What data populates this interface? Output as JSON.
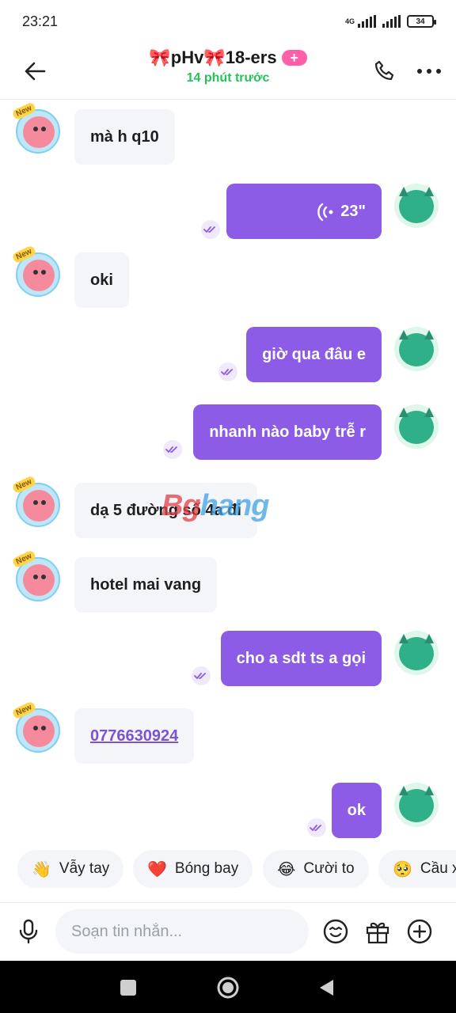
{
  "status_bar": {
    "time": "23:21",
    "network": "4G",
    "battery": "34"
  },
  "header": {
    "title": "🎀pHv🎀18-ers",
    "plus_badge": "+",
    "subtitle": "14 phút trước"
  },
  "messages": [
    {
      "side": "in",
      "text": "mà h q10"
    },
    {
      "side": "out",
      "type": "voice",
      "duration": "23\""
    },
    {
      "side": "in",
      "text": "oki"
    },
    {
      "side": "out",
      "text": "giờ qua đâu e"
    },
    {
      "side": "out",
      "text": "nhanh nào baby trễ r"
    },
    {
      "side": "in",
      "text": "dạ 5 đường số 4a đi"
    },
    {
      "side": "in",
      "text": "hotel mai vang"
    },
    {
      "side": "out",
      "text": "cho a sdt ts a gọi"
    },
    {
      "side": "in",
      "text": "0776630924",
      "link": true
    },
    {
      "side": "out",
      "text": "ok"
    }
  ],
  "watermark": {
    "part1": "Bg",
    "part2": "hang"
  },
  "quick_reactions": [
    {
      "emoji": "👋",
      "label": "Vẫy tay"
    },
    {
      "emoji": "❤️",
      "label": "Bóng bay"
    },
    {
      "emoji": "😂",
      "label": "Cười to"
    },
    {
      "emoji": "🥺",
      "label": "Cầu x"
    }
  ],
  "composer": {
    "placeholder": "Soạn tin nhắn..."
  },
  "avatar_badge": "New"
}
